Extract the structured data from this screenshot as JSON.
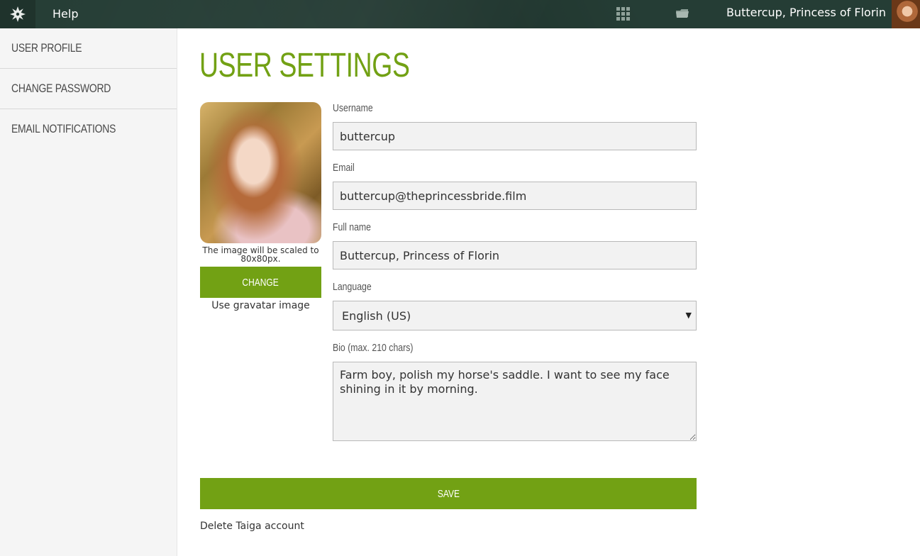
{
  "topbar": {
    "logo_icon": "taiga-logo-icon",
    "help_label": "Help",
    "apps_icon": "grid-icon",
    "projects_icon": "folder-icon",
    "user_name": "Buttercup, Princess of Florin"
  },
  "sidebar": {
    "items": [
      {
        "label": "USER PROFILE"
      },
      {
        "label": "CHANGE PASSWORD"
      },
      {
        "label": "EMAIL NOTIFICATIONS"
      }
    ]
  },
  "main": {
    "title": "USER SETTINGS",
    "avatar": {
      "scale_note": "The image will be scaled to 80x80px.",
      "change_label": "CHANGE",
      "gravatar_label": "Use gravatar image"
    },
    "form": {
      "username_label": "Username",
      "username_value": "buttercup",
      "email_label": "Email",
      "email_value": "buttercup@theprincessbride.film",
      "fullname_label": "Full name",
      "fullname_value": "Buttercup, Princess of Florin",
      "language_label": "Language",
      "language_value": "English (US)",
      "bio_label": "Bio (max. 210 chars)",
      "bio_value": "Farm boy, polish my horse's saddle. I want to see my face shining in it by morning."
    },
    "save_label": "SAVE",
    "delete_label": "Delete Taiga account"
  },
  "colors": {
    "accent": "#72a114",
    "topbar": "#253d35",
    "sidebar_bg": "#f5f5f5"
  }
}
